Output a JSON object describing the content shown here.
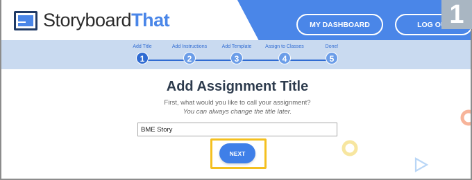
{
  "header": {
    "logo_prefix": "Storyboard",
    "logo_suffix": "That",
    "dashboard_label": "MY DASHBOARD",
    "logout_label": "LOG OUT",
    "step_badge": "1"
  },
  "progress": {
    "steps": [
      {
        "label": "Add Title",
        "number": "1",
        "active": true
      },
      {
        "label": "Add Instructions",
        "number": "2",
        "active": false
      },
      {
        "label": "Add Template",
        "number": "3",
        "active": false
      },
      {
        "label": "Assign to Classes",
        "number": "4",
        "active": false
      },
      {
        "label": "Done!",
        "number": "5",
        "active": false
      }
    ]
  },
  "main": {
    "title": "Add Assignment Title",
    "subtitle": "First, what would you like to call your assignment?",
    "hint": "You can always change the title later.",
    "title_input_value": "BME Story",
    "next_label": "NEXT"
  },
  "colors": {
    "brand_blue": "#4a86e8",
    "progress_bg": "#c9daf0",
    "highlight": "#f4c020"
  }
}
